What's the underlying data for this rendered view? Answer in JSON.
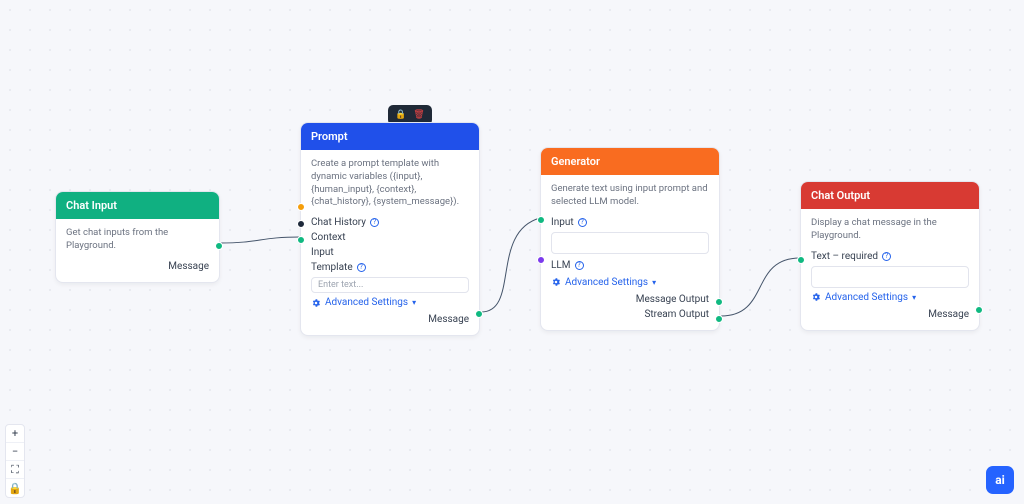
{
  "nodes": {
    "chat_input": {
      "title": "Chat Input",
      "desc": "Get chat inputs from the Playground.",
      "out_message": "Message"
    },
    "prompt": {
      "title": "Prompt",
      "desc": "Create a prompt template with dynamic variables ({input}, {human_input}, {context}, {chat_history}, {system_message}).",
      "ports": {
        "chat_history": "Chat History",
        "context": "Context",
        "input": "Input"
      },
      "template_label": "Template",
      "template_placeholder": "Enter text...",
      "out_message": "Message"
    },
    "generator": {
      "title": "Generator",
      "desc": "Generate text using input prompt and selected LLM model.",
      "input_label": "Input",
      "llm_label": "LLM",
      "out_message": "Message Output",
      "out_stream": "Stream Output"
    },
    "chat_output": {
      "title": "Chat Output",
      "desc": "Display a chat message in the Playground.",
      "text_label": "Text – required",
      "out_message": "Message"
    }
  },
  "labels": {
    "advanced": "Advanced Settings"
  },
  "colors": {
    "chat_input": "#10b081",
    "prompt": "#2050ea",
    "generator": "#f96c20",
    "chat_output": "#d83a33"
  },
  "fab": "ai"
}
